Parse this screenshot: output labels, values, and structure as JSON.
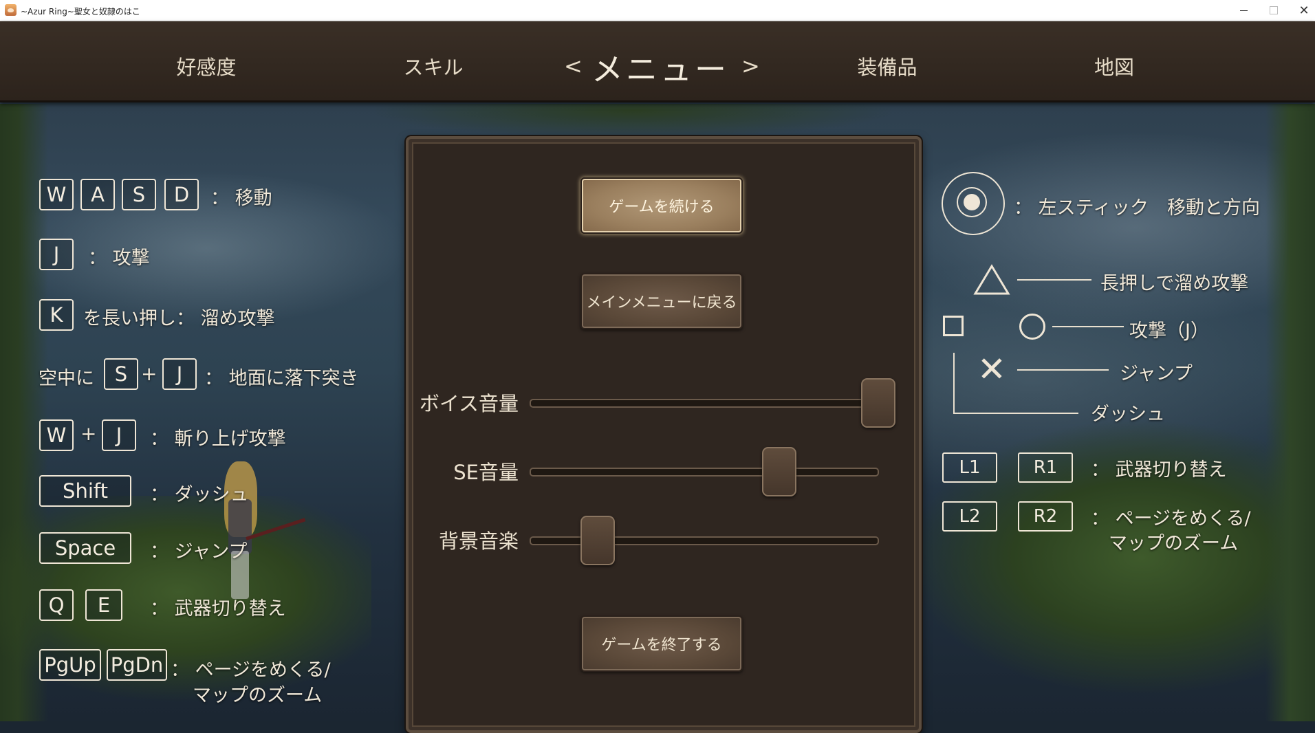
{
  "window": {
    "title": "~Azur Ring~聖女と奴隷のはこ",
    "controls": {
      "minimize": "—",
      "close": "✕"
    }
  },
  "nav": {
    "tabs": [
      "好感度",
      "スキル",
      "メニュー",
      "装備品",
      "地図"
    ],
    "active": "メニュー",
    "prev_arrow": "<",
    "next_arrow": ">"
  },
  "menu": {
    "continue_label": "ゲームを続ける",
    "main_menu_label": "メインメニューに戻る",
    "quit_label": "ゲームを終了する",
    "volume": {
      "voice": {
        "label": "ボイス音量",
        "level": 1.0
      },
      "se": {
        "label": "SE音量",
        "level": 0.7
      },
      "bgm": {
        "label": "背景音楽",
        "level": 0.15
      }
    }
  },
  "keyboard": {
    "move": {
      "keys": [
        "W",
        "A",
        "S",
        "D"
      ],
      "desc": "： 移動"
    },
    "attack": {
      "key": "J",
      "desc": "： 攻撃"
    },
    "charge": {
      "key": "K",
      "desc": "を長い押し： 溜め攻撃"
    },
    "dive": {
      "prefix": "空中に",
      "keys": [
        "S",
        "J"
      ],
      "plus": "+",
      "desc": "： 地面に落下突き"
    },
    "uppercut": {
      "keys": [
        "W",
        "J"
      ],
      "plus": "+",
      "desc": "： 斬り上げ攻撃"
    },
    "dash": {
      "key": "Shift",
      "desc": "： ダッシュ"
    },
    "jump": {
      "key": "Space",
      "desc": "： ジャンプ"
    },
    "weapon": {
      "keys": [
        "Q",
        "E"
      ],
      "desc": "： 武器切り替え"
    },
    "page": {
      "keys": [
        "PgUp",
        "PgDn"
      ],
      "desc_line1": "： ページをめくる/",
      "desc_line2": "マップのズーム"
    }
  },
  "gamepad": {
    "stick_desc": "： 左スティック　移動と方向",
    "triangle_desc": "長押しで溜め攻撃",
    "circle_desc": "攻撃（J）",
    "cross_desc": "ジャンプ",
    "square_desc": "ダッシュ",
    "shoulder_top": {
      "keys": [
        "L1",
        "R1"
      ],
      "desc": "： 武器切り替え"
    },
    "shoulder_bottom": {
      "keys": [
        "L2",
        "R2"
      ],
      "desc_line1": "： ページをめくる/",
      "desc_line2": "マップのズーム"
    }
  },
  "colors": {
    "nav_bg": "#2c231c",
    "panel_bg": "#2f2620",
    "button_bg": "#5a4838",
    "button_active_bg": "#9a7f5e",
    "text": "#f0e8d8"
  },
  "icons": {
    "stick": "left-stick-icon",
    "triangle": "triangle-button-icon",
    "circle": "circle-button-icon",
    "cross": "cross-button-icon",
    "square": "square-button-icon"
  }
}
